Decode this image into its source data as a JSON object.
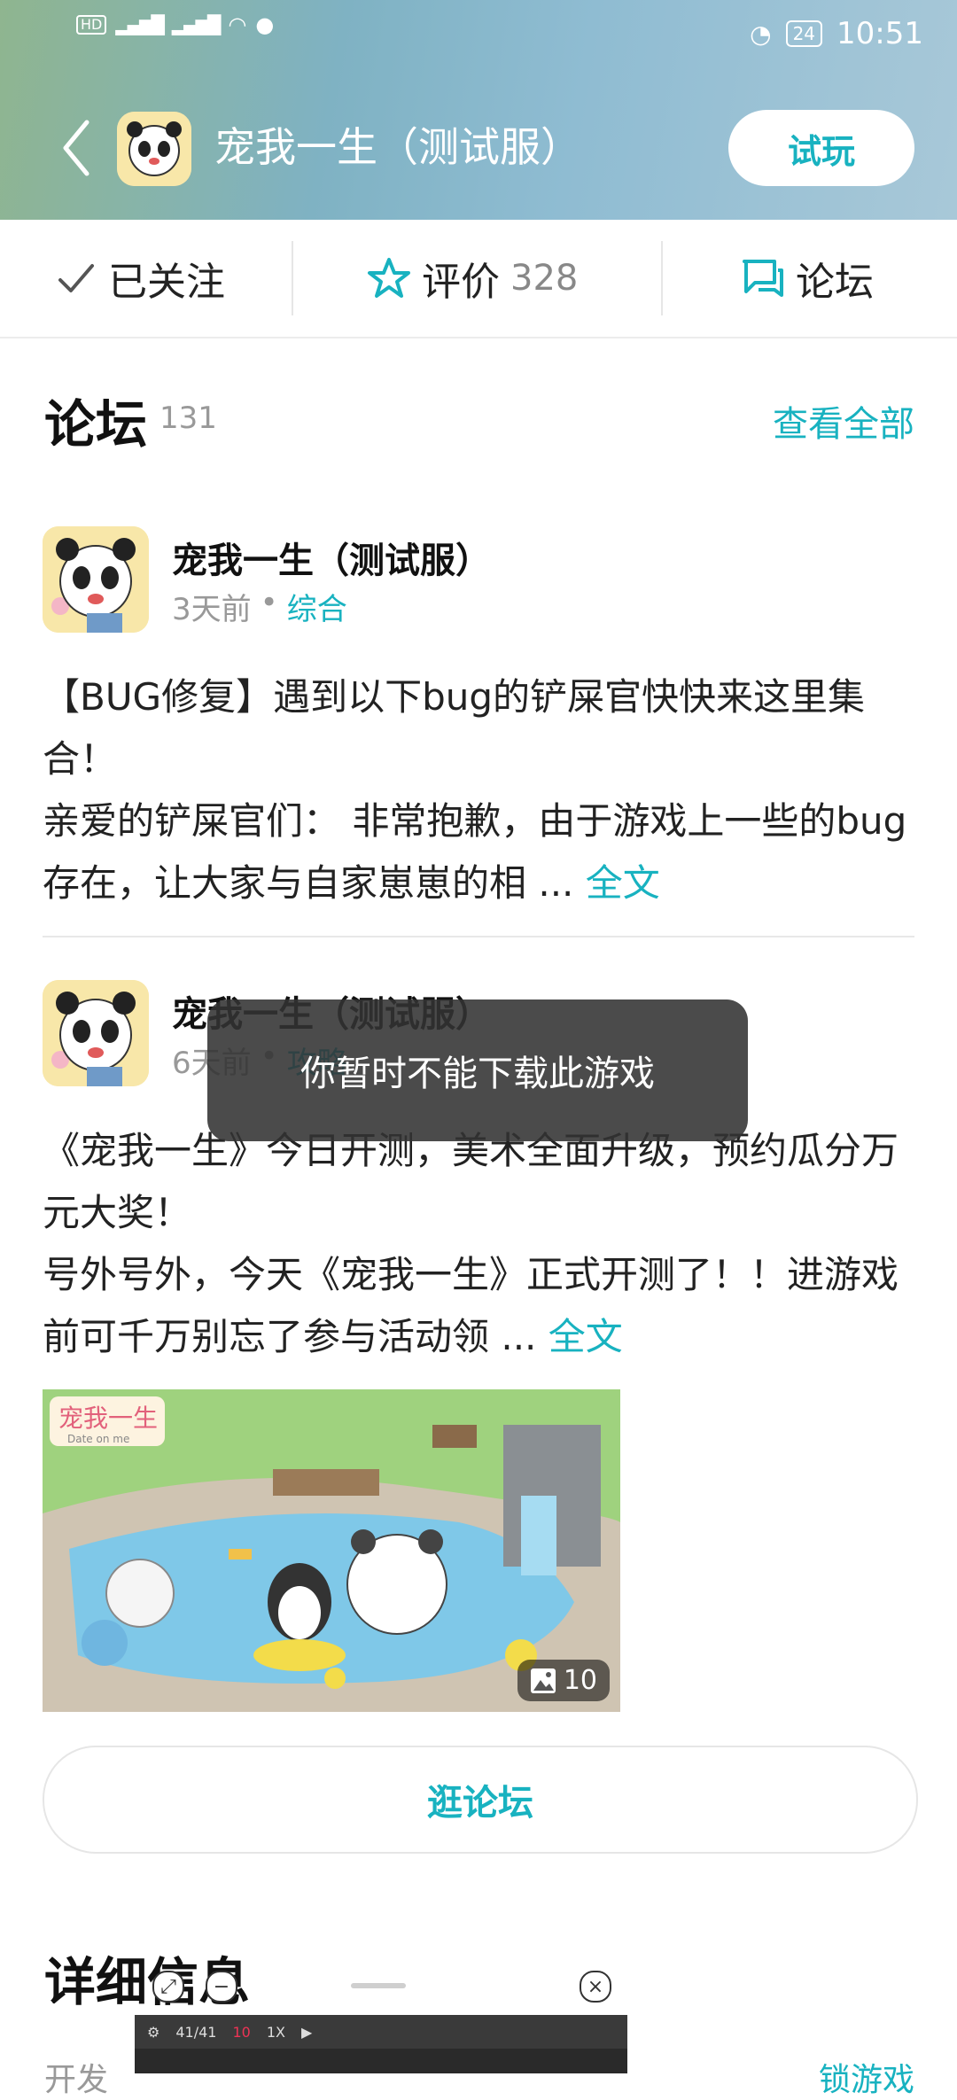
{
  "status": {
    "time": "10:51",
    "battery": "24",
    "network": "4G"
  },
  "header": {
    "title": "宠我一生（测试服）",
    "try_button": "试玩"
  },
  "tabs": {
    "follow": "已关注",
    "rate": "评价",
    "rate_count": "328",
    "forum": "论坛"
  },
  "forum": {
    "title": "论坛",
    "count": "131",
    "see_all": "查看全部",
    "posts": [
      {
        "name": "宠我一生（测试服）",
        "time": "3天前",
        "category": "综合",
        "line1": "【BUG修复】遇到以下bug的铲屎官快快来这里集合！",
        "line2": "亲爱的铲屎官们： 非常抱歉，由于游戏上一些的bug存在，让大家与自家崽崽的相 ...",
        "more": "全文"
      },
      {
        "name": "宠我一生（测试服）",
        "time": "6天前",
        "category": "攻略",
        "line1": "《宠我一生》今日开测，美术全面升级，预约瓜分万元大奖！",
        "line2": "号外号外，今天《宠我一生》正式开测了！！进游戏前可千万别忘了参与活动领 ...",
        "more": "全文",
        "image_count": "10",
        "image_logo": "宠我一生",
        "image_sub": "Date on me"
      }
    ],
    "browse_button": "逛论坛"
  },
  "toast": "你暂时不能下载此游戏",
  "detail": {
    "title": "详细信息",
    "left": "开发",
    "right": "锁游戏"
  },
  "floating": {
    "counter": "41/41",
    "level": "10",
    "speed": "1X"
  }
}
